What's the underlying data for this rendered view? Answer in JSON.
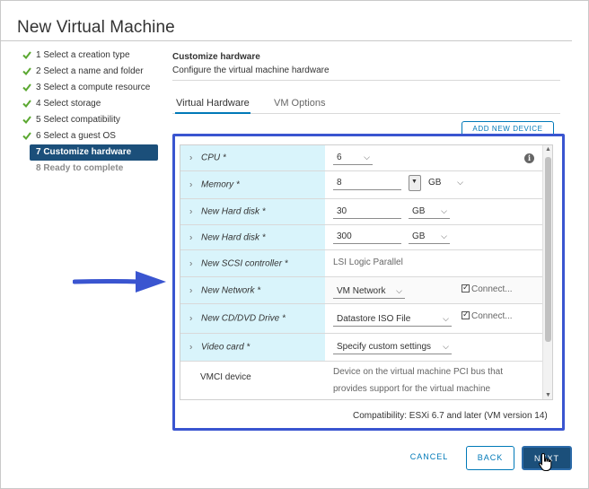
{
  "dialog": {
    "title": "New Virtual Machine"
  },
  "steps": [
    {
      "label": "1 Select a creation type",
      "state": "done"
    },
    {
      "label": "2 Select a name and folder",
      "state": "done"
    },
    {
      "label": "3 Select a compute resource",
      "state": "done"
    },
    {
      "label": "4 Select storage",
      "state": "done"
    },
    {
      "label": "5 Select compatibility",
      "state": "done"
    },
    {
      "label": "6 Select a guest OS",
      "state": "done"
    },
    {
      "label": "7 Customize hardware",
      "state": "active"
    },
    {
      "label": "8 Ready to complete",
      "state": "pending"
    }
  ],
  "content": {
    "title": "Customize hardware",
    "subtitle": "Configure the virtual machine hardware"
  },
  "tabs": [
    {
      "label": "Virtual Hardware",
      "selected": true
    },
    {
      "label": "VM Options",
      "selected": false
    }
  ],
  "add_device_label": "ADD NEW DEVICE",
  "hardware": {
    "cpu": {
      "name": "CPU *",
      "value": "6"
    },
    "memory": {
      "name": "Memory *",
      "value": "8",
      "unit": "GB"
    },
    "disk1": {
      "name": "New Hard disk *",
      "value": "30",
      "unit": "GB"
    },
    "disk2": {
      "name": "New Hard disk *",
      "value": "300",
      "unit": "GB"
    },
    "scsi": {
      "name": "New SCSI controller *",
      "value": "LSI Logic Parallel"
    },
    "network": {
      "name": "New Network *",
      "value": "VM Network",
      "connect_label": "Connect...",
      "connected": true
    },
    "cdrom": {
      "name": "New CD/DVD Drive *",
      "value": "Datastore ISO File",
      "connect_label": "Connect...",
      "connected": true
    },
    "video": {
      "name": "Video card *",
      "value": "Specify custom settings"
    },
    "vmci": {
      "name": "VMCI device",
      "line1": "Device on the virtual machine PCI bus that",
      "line2": "provides support for the virtual machine"
    }
  },
  "compatibility": "Compatibility: ESXi 6.7 and later (VM version 14)",
  "buttons": {
    "cancel": "CANCEL",
    "back": "BACK",
    "next": "NEXT"
  },
  "colors": {
    "accent": "#0079b8",
    "active_step": "#1b4f7a",
    "check": "#5ba831",
    "highlight_frame": "#3a55d0",
    "name_cell": "#d9f4fb"
  },
  "icons": {
    "check": "check-icon",
    "chevron": "chevron-right-icon",
    "caret": "caret-down-icon",
    "info": "info-icon",
    "arrow": "arrow-right-annotation",
    "cursor": "hand-cursor"
  }
}
